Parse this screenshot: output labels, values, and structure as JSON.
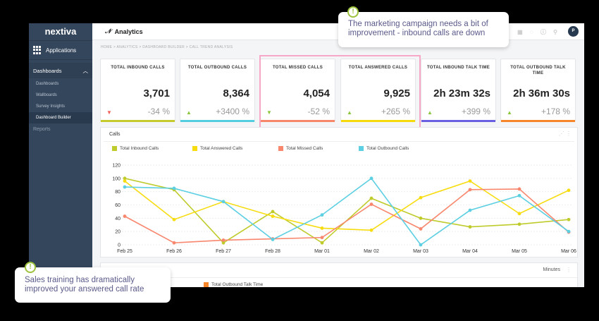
{
  "brand": "nextiva",
  "sidebar": {
    "applications": "Applications",
    "section": "Dashboards",
    "items": [
      "Dashboards",
      "Wallboards",
      "Survey Insights",
      "Dashboard Builder"
    ],
    "active": "Dashboard Builder",
    "reports": "Reports"
  },
  "header": {
    "title": "Analytics",
    "avatar": "P"
  },
  "breadcrumb": "HOME > ANALYTICS > DASHBOARD BUILDER > CALL TREND ANALYSIS",
  "cards": [
    {
      "title": "TOTAL INBOUND CALLS",
      "value": "3,701",
      "change": "-34 %",
      "trend": "down",
      "arrow_color": "#f0605a",
      "bar_color": "#c5cb2d"
    },
    {
      "title": "TOTAL OUTBOUND CALLS",
      "value": "8,364",
      "change": "+3400 %",
      "trend": "up",
      "arrow_color": "#8cc63e",
      "bar_color": "#55cde0"
    },
    {
      "title": "TOTAL MISSED CALLS",
      "value": "4,054",
      "change": "-52 %",
      "trend": "down",
      "arrow_color": "#8cc63e",
      "bar_color": "#f7876a"
    },
    {
      "title": "TOTAL ANSWERED CALLS",
      "value": "9,925",
      "change": "+265 %",
      "trend": "up",
      "arrow_color": "#8cc63e",
      "bar_color": "#f5d90a"
    },
    {
      "title": "TOTAL INBOUND TALK TIME",
      "value": "2h 23m 32s",
      "change": "+399 %",
      "trend": "up",
      "arrow_color": "#8cc63e",
      "bar_color": "#6a5fe0"
    },
    {
      "title": "TOTAL OUTBOUND TALK TIME",
      "value": "2h 36m 30s",
      "change": "+178 %",
      "trend": "up",
      "arrow_color": "#8cc63e",
      "bar_color": "#f7862a"
    }
  ],
  "panel2": {
    "unit": "Minutes",
    "legend": "Total Outbound Talk Time",
    "legend_color": "#f7862a"
  },
  "tooltips": [
    "The marketing campaign needs a bit of improvement - inbound calls are down",
    "Sales training has dramatically improved your answered call rate"
  ],
  "chart_data": {
    "type": "line",
    "title": "Calls",
    "categories": [
      "Feb 25",
      "Feb 26",
      "Feb 27",
      "Feb 28",
      "Mar 01",
      "Mar 02",
      "Mar 03",
      "Mar 04",
      "Mar 05",
      "Mar 06"
    ],
    "ylim": [
      0,
      120
    ],
    "yticks": [
      0,
      20,
      40,
      60,
      80,
      100,
      120
    ],
    "grid": true,
    "legend": "top-left",
    "series": [
      {
        "name": "Total Inbound Calls",
        "color": "#bfcb2a",
        "values": [
          100,
          83,
          3,
          50,
          3,
          70,
          40,
          27,
          31,
          38
        ]
      },
      {
        "name": "Total Answered Calls",
        "color": "#f7dc10",
        "values": [
          96,
          38,
          65,
          43,
          25,
          22,
          71,
          96,
          47,
          82
        ]
      },
      {
        "name": "Total Missed Calls",
        "color": "#f8876e",
        "values": [
          43,
          3,
          7,
          9,
          11,
          61,
          24,
          83,
          84,
          19
        ]
      },
      {
        "name": "Total Outbound Calls",
        "color": "#5ccfe2",
        "values": [
          87,
          85,
          65,
          8,
          45,
          100,
          0,
          52,
          74,
          20
        ]
      }
    ]
  }
}
